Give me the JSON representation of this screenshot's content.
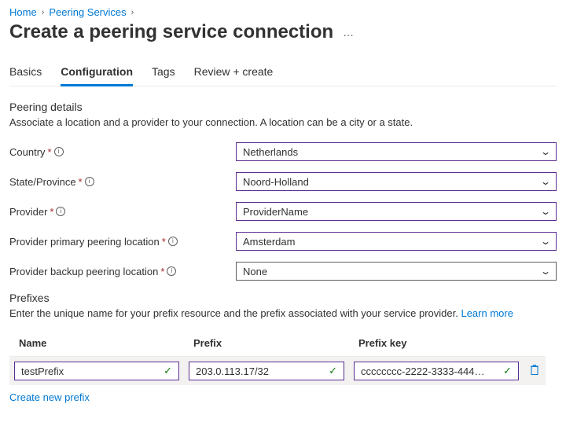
{
  "breadcrumb": {
    "home": "Home",
    "peering": "Peering Services"
  },
  "title": "Create a peering service connection",
  "tabs": {
    "basics": "Basics",
    "config": "Configuration",
    "tags": "Tags",
    "review": "Review + create"
  },
  "peering": {
    "section_title": "Peering details",
    "section_desc": "Associate a location and a provider to your connection. A location can be a city or a state.",
    "country_label": "Country",
    "country_value": "Netherlands",
    "state_label": "State/Province",
    "state_value": "Noord-Holland",
    "provider_label": "Provider",
    "provider_value": "ProviderName",
    "primary_label": "Provider primary peering location",
    "primary_value": "Amsterdam",
    "backup_label": "Provider backup peering location",
    "backup_value": "None"
  },
  "prefixes": {
    "heading": "Prefixes",
    "desc": "Enter the unique name for your prefix resource and the prefix associated with your service provider. ",
    "learn": "Learn more",
    "col_name": "Name",
    "col_prefix": "Prefix",
    "col_key": "Prefix key",
    "row": {
      "name": "testPrefix",
      "prefix": "203.0.113.17/32",
      "key": "cccccccc-2222-3333-4444-d..."
    },
    "create_label": "Create new prefix"
  }
}
